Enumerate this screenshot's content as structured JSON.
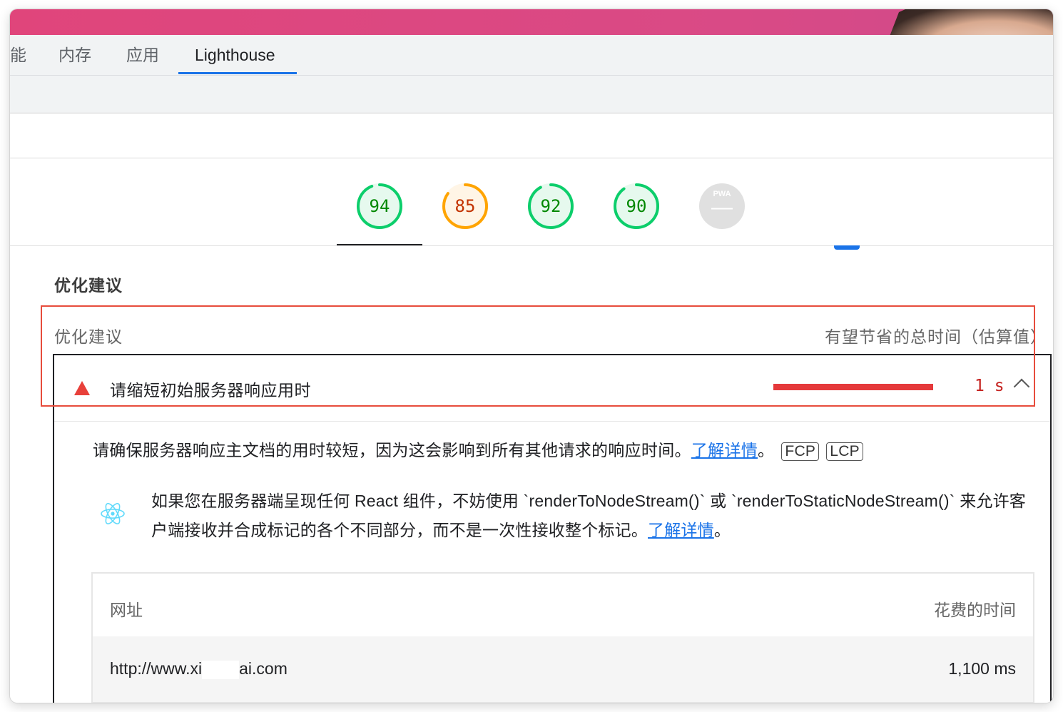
{
  "colors": {
    "pass": "#0cce6b",
    "average": "#ffa400",
    "fail": "#e8403a",
    "link": "#1a73e8",
    "highlight_outline": "#e74c3c"
  },
  "devtools": {
    "tabs": [
      {
        "label": "能"
      },
      {
        "label": "内存"
      },
      {
        "label": "应用"
      },
      {
        "label": "Lighthouse"
      }
    ]
  },
  "scores": [
    {
      "value": "94",
      "level": "pass",
      "fraction": 0.94
    },
    {
      "value": "85",
      "level": "average",
      "fraction": 0.85
    },
    {
      "value": "92",
      "level": "pass",
      "fraction": 0.92
    },
    {
      "value": "90",
      "level": "pass",
      "fraction": 0.9
    },
    {
      "value": "PWA",
      "symbol": "—",
      "level": "na"
    }
  ],
  "section": {
    "title": "优化建议",
    "col_left": "优化建议",
    "col_right": "有望节省的总时间（估算值）"
  },
  "audit": {
    "icon": "warning-triangle-icon",
    "title": "请缩短初始服务器响应用时",
    "savings": "1 s",
    "description": "请确保服务器响应主文档的用时较短，因为这会影响到所有其他请求的响应时间。",
    "learn_more": "了解详情",
    "period": "。",
    "tags": [
      "FCP",
      "LCP"
    ],
    "react_tip": "如果您在服务器端呈现任何 React 组件，不妨使用 `renderToNodeStream()` 或 `renderToStaticNodeStream()` 来允许客户端接收并合成标记的各个不同部分，而不是一次性接收整个标记。",
    "react_learn_more": "了解详情",
    "react_period": "。",
    "table": {
      "col_url": "网址",
      "col_time": "花费的时间",
      "rows": [
        {
          "url_start": "http://www.xi",
          "url_end": "ai.com",
          "time": "1,100 ms"
        }
      ]
    }
  }
}
